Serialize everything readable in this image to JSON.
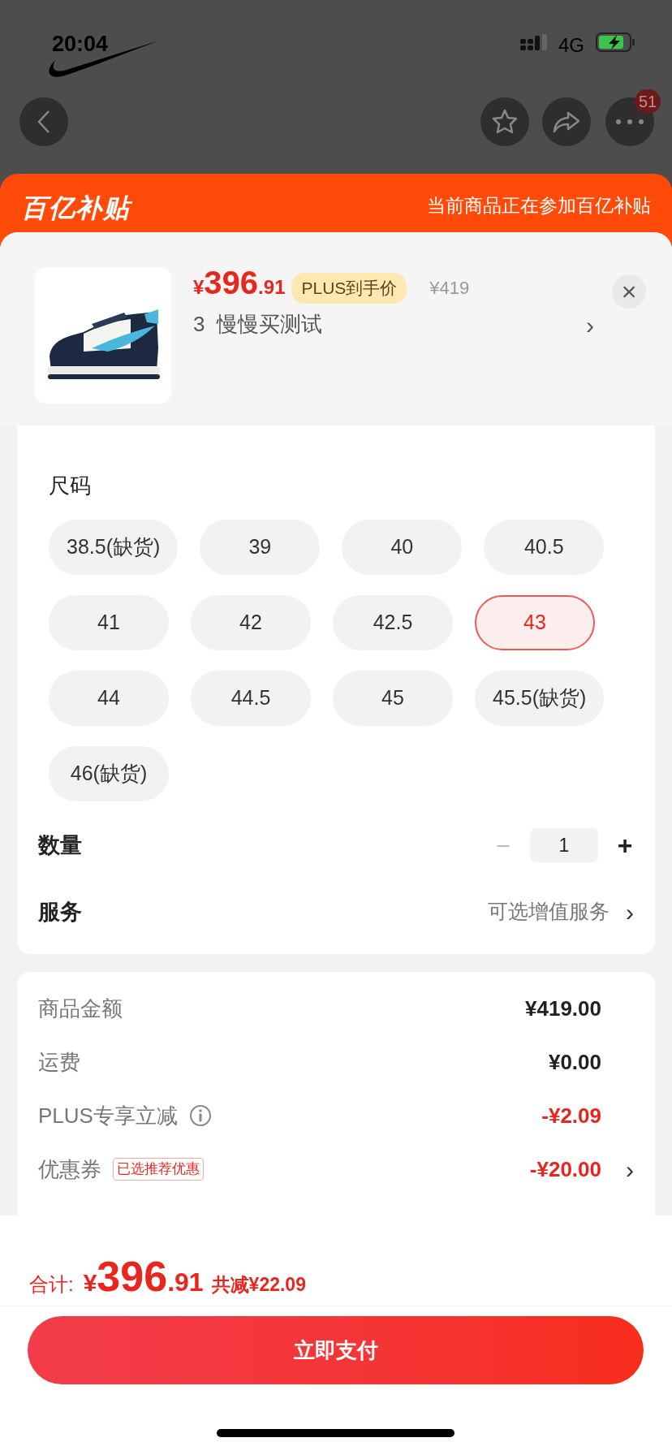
{
  "status_bar": {
    "time": "20:04",
    "network": "4G"
  },
  "nav": {
    "badge": "51"
  },
  "banner": {
    "logo": "百亿补贴",
    "text": "当前商品正在参加百亿补贴"
  },
  "product": {
    "currency": "¥",
    "price_int": "396",
    "price_dec": ".91",
    "price_tag": "PLUS到手价",
    "original_price": "¥419",
    "title": "3  慢慢买测试",
    "arrow": "›",
    "close": "×"
  },
  "sizes": {
    "label": "尺码",
    "options": [
      {
        "label": "38.5(缺货)",
        "selected": false
      },
      {
        "label": "39",
        "selected": false
      },
      {
        "label": "40",
        "selected": false
      },
      {
        "label": "40.5",
        "selected": false
      },
      {
        "label": "41",
        "selected": false
      },
      {
        "label": "42",
        "selected": false
      },
      {
        "label": "42.5",
        "selected": false
      },
      {
        "label": "43",
        "selected": true
      },
      {
        "label": "44",
        "selected": false
      },
      {
        "label": "44.5",
        "selected": false
      },
      {
        "label": "45",
        "selected": false
      },
      {
        "label": "45.5(缺货)",
        "selected": false
      },
      {
        "label": "46(缺货)",
        "selected": false
      }
    ]
  },
  "quantity": {
    "label": "数量",
    "minus": "−",
    "value": "1",
    "plus": "+",
    "minus_disabled": true
  },
  "service": {
    "label": "服务",
    "value": "可选增值服务",
    "arrow": "›"
  },
  "summary": [
    {
      "label": "商品金额",
      "value": "¥419.00",
      "discount": false,
      "info": false
    },
    {
      "label": "运费",
      "value": "¥0.00",
      "discount": false,
      "info": false
    },
    {
      "label": "PLUS专享立减",
      "value": "-¥2.09",
      "discount": true,
      "info": true
    },
    {
      "label": "优惠券",
      "tag": "已选推荐优惠",
      "value": "-¥20.00",
      "discount": true,
      "info": false,
      "arrow": "›"
    }
  ],
  "total": {
    "label": "合计:",
    "currency": "¥",
    "amount_int": "396",
    "amount_dec": ".91",
    "saved": "共减¥22.09"
  },
  "pay_button": "立即支付"
}
